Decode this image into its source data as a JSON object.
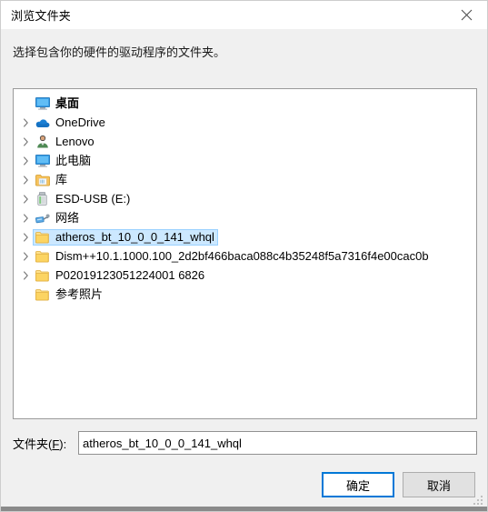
{
  "window": {
    "title": "浏览文件夹",
    "close_icon": "close-icon"
  },
  "instruction": "选择包含你的硬件的驱动程序的文件夹。",
  "tree": {
    "items": [
      {
        "label": "桌面",
        "icon": "desktop-monitor-icon",
        "level": 0,
        "expandable": false,
        "selected": false,
        "bold": true
      },
      {
        "label": "OneDrive",
        "icon": "onedrive-cloud-icon",
        "level": 1,
        "expandable": true,
        "selected": false,
        "bold": false
      },
      {
        "label": "Lenovo",
        "icon": "user-account-icon",
        "level": 1,
        "expandable": true,
        "selected": false,
        "bold": false
      },
      {
        "label": "此电脑",
        "icon": "this-pc-monitor-icon",
        "level": 1,
        "expandable": true,
        "selected": false,
        "bold": false
      },
      {
        "label": "库",
        "icon": "library-folder-icon",
        "level": 1,
        "expandable": true,
        "selected": false,
        "bold": false
      },
      {
        "label": "ESD-USB (E:)",
        "icon": "usb-drive-icon",
        "level": 1,
        "expandable": true,
        "selected": false,
        "bold": false
      },
      {
        "label": "网络",
        "icon": "network-icon",
        "level": 1,
        "expandable": true,
        "selected": false,
        "bold": false
      },
      {
        "label": "atheros_bt_10_0_0_141_whql",
        "icon": "folder-icon",
        "level": 1,
        "expandable": true,
        "selected": true,
        "bold": false
      },
      {
        "label": "Dism++10.1.1000.100_2d2bf466baca088c4b35248f5a7316f4e00cac0b",
        "icon": "folder-icon",
        "level": 1,
        "expandable": true,
        "selected": false,
        "bold": false
      },
      {
        "label": "P02019123051224001 6826",
        "icon": "folder-icon",
        "level": 1,
        "expandable": true,
        "selected": false,
        "bold": false
      },
      {
        "label": "参考照片",
        "icon": "folder-icon",
        "level": 1,
        "expandable": false,
        "selected": false,
        "bold": false
      }
    ]
  },
  "folder_field": {
    "label_prefix": "文件夹(",
    "label_accel": "F",
    "label_suffix": "):",
    "value": "atheros_bt_10_0_0_141_whql"
  },
  "buttons": {
    "ok": "确定",
    "cancel": "取消"
  },
  "colors": {
    "selection": "#cce8ff",
    "focus_border": "#0078d7",
    "dialog_bg": "#f0f0f0",
    "panel_bg": "#ffffff"
  }
}
